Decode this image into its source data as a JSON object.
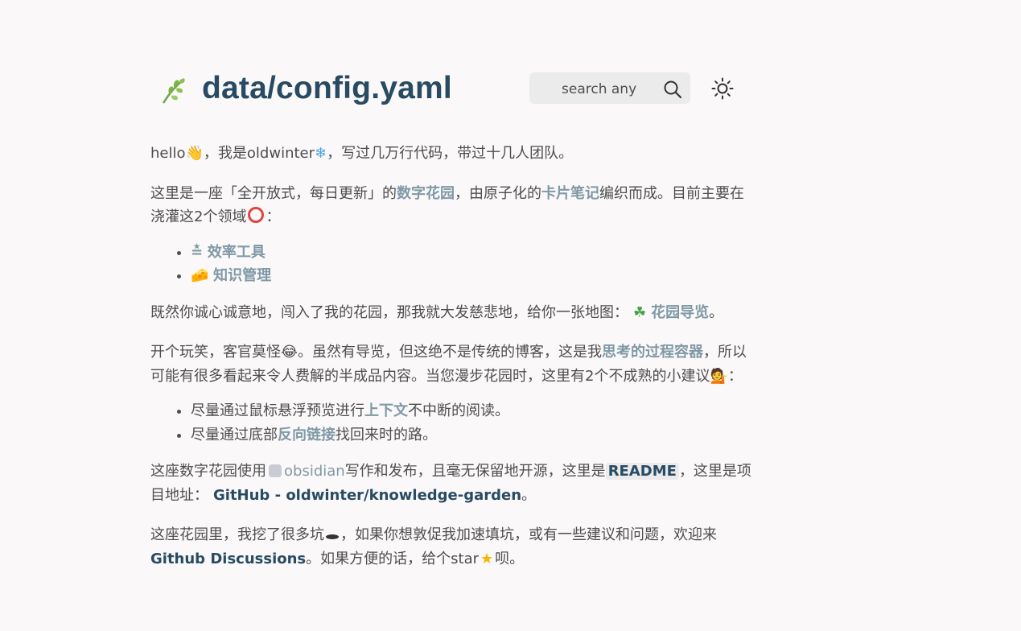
{
  "header": {
    "title": "data/config.yaml",
    "search_placeholder": "search any"
  },
  "intro": {
    "greet_pre": "hello",
    "greet_mid": "，我是oldwinter",
    "greet_post": "，写过几万行代码，带过十几人团队。"
  },
  "p2": {
    "t1": "这里是一座「全开放式，每日更新」的",
    "link1": "数字花园",
    "t2": "，由原子化的",
    "link2": "卡片笔记",
    "t3": "编织而成。目前主要在浇灌这2个领域",
    "t4": "："
  },
  "domains": [
    {
      "icon": "≛",
      "label": "效率工具"
    },
    {
      "icon": "🧀",
      "label": "知识管理"
    }
  ],
  "p3": {
    "t1": "既然你诚心诚意地，闯入了我的花园，那我就大发慈悲地，给你一张地图：",
    "icon": "☘",
    "link": "花园导览",
    "t2": "。"
  },
  "p4": {
    "t1": "开个玩笑，客官莫怪",
    "t2": "。虽然有导览，但这绝不是传统的博客，这是我",
    "link": "思考的过程容器",
    "t3": "，所以可能有很多看起来令人费解的半成品内容。当您漫步花园时，这里有2个不成熟的小建议",
    "t4": "："
  },
  "tips": [
    {
      "pre": "尽量通过鼠标悬浮预览进行",
      "link": "上下文",
      "post": "不中断的阅读。"
    },
    {
      "pre": "尽量通过底部",
      "link": "反向链接",
      "post": "找回来时的路。"
    }
  ],
  "p5": {
    "t1": "这座数字花园使用",
    "link1": "obsidian",
    "t2": "写作和发布，且毫无保留地开源，这里是",
    "code": "README",
    "t3": "，这里是项目地址：",
    "link2": "GitHub - oldwinter/knowledge-garden",
    "t4": "。"
  },
  "p6": {
    "t1": "这座花园里，我挖了很多坑",
    "t2": "，如果你想敦促我加速填坑，或有一些建议和问题，欢迎来 ",
    "link": "Github Discussions",
    "t3": "。如果方便的话，给个star",
    "t4": "呗。"
  }
}
